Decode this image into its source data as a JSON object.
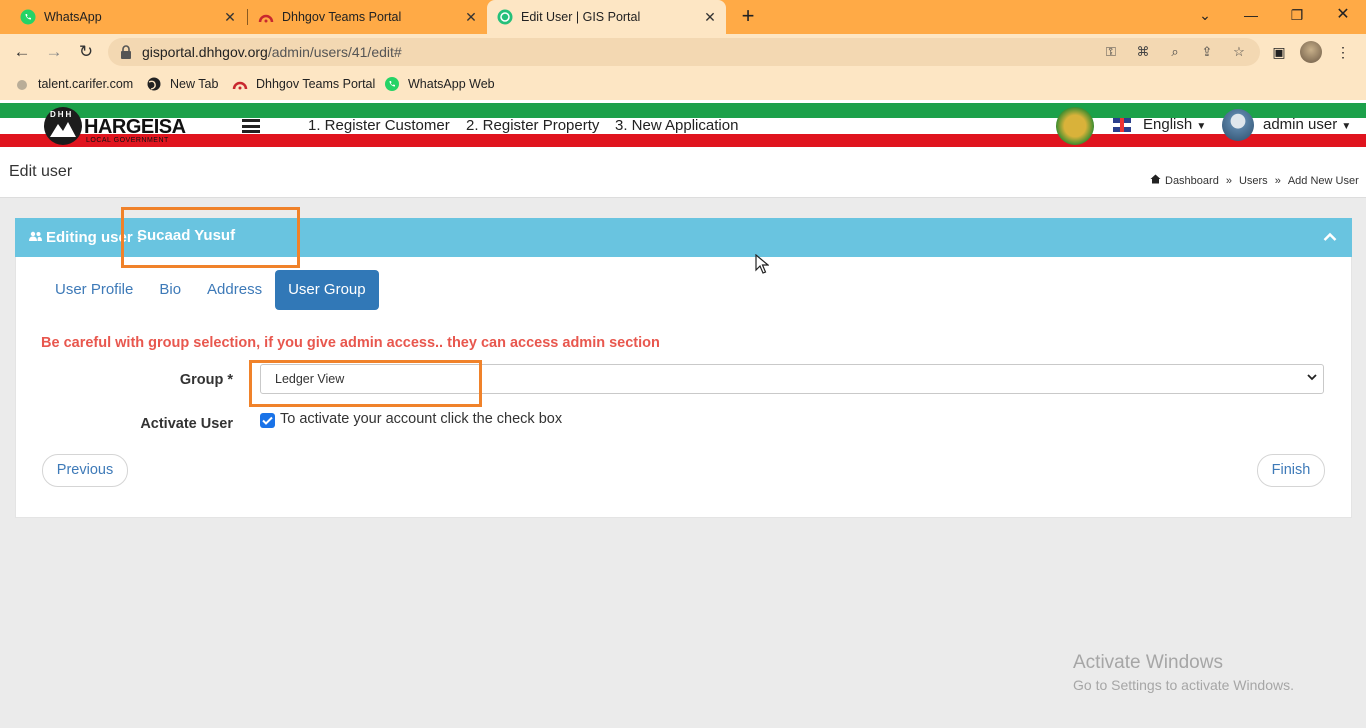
{
  "browser": {
    "tabs": [
      {
        "title": "WhatsApp"
      },
      {
        "title": "Dhhgov Teams Portal"
      },
      {
        "title": "Edit User | GIS Portal"
      }
    ],
    "url_host": "gisportal.dhhgov.org",
    "url_path": "/admin/users/41/edit#",
    "bookmarks": [
      {
        "label": "talent.carifer.com"
      },
      {
        "label": "New Tab"
      },
      {
        "label": "Dhhgov Teams Portal"
      },
      {
        "label": "WhatsApp Web"
      }
    ]
  },
  "site": {
    "logo_text": "HARGEISA",
    "logo_sub": "LOCAL GOVERNMENT",
    "logo_letters": "DHH",
    "nav": [
      {
        "label": "1. Register Customer"
      },
      {
        "label": "2. Register Property"
      },
      {
        "label": "3. New Application"
      }
    ],
    "language": "English",
    "user": "admin user"
  },
  "page": {
    "title": "Edit user",
    "breadcrumb": [
      "Dashboard",
      "Users",
      "Add New User"
    ],
    "breadcrumb_sep": "»"
  },
  "panel": {
    "heading_label": "Editing user :",
    "heading_name": "Sucaad Yusuf",
    "tabs": [
      {
        "label": "User Profile",
        "active": false
      },
      {
        "label": "Bio",
        "active": false
      },
      {
        "label": "Address",
        "active": false
      },
      {
        "label": "User Group",
        "active": true
      }
    ],
    "warning": "Be careful with group selection, if you give admin access.. they can access admin section",
    "group_label": "Group *",
    "group_value": "Ledger View",
    "activate_label": "Activate User",
    "activate_checked": true,
    "activate_text": "To activate your account click the check box",
    "previous_label": "Previous",
    "finish_label": "Finish"
  },
  "watermark": {
    "line1": "Activate Windows",
    "line2": "Go to Settings to activate Windows."
  },
  "colors": {
    "tabstrip": "#ffaa46",
    "toolbar": "#fde6c4",
    "panel_header": "#69c4e0",
    "active_tab": "#3178b7",
    "warning": "#e8574e",
    "highlight": "#f0822a"
  }
}
